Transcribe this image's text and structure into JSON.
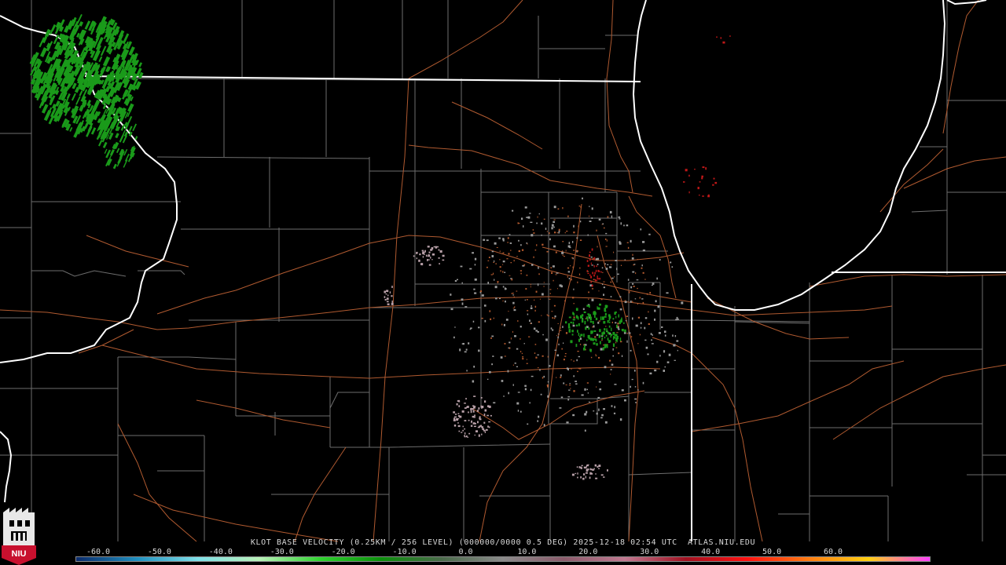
{
  "title": "KLOT BASE VELOCITY (0.25KM / 256 LEVEL) (000000/0000 0.5 DEG) 2025-12-18 02:54 UTC  ATLAS.NIU.EDU",
  "logo": {
    "text": "NIU",
    "colors": {
      "shield": "#c8102e",
      "tower": "#ffffff"
    }
  },
  "colorbar": {
    "ticks": [
      "-60.0",
      "-50.0",
      "-40.0",
      "-30.0",
      "-20.0",
      "-10.0",
      "0.0",
      "10.0",
      "20.0",
      "30.0",
      "40.0",
      "50.0",
      "60.0"
    ],
    "colors": [
      "#0a2a6a",
      "#1f8fbf",
      "#7fe0e8",
      "#b8f0b8",
      "#2fd22f",
      "#0b8f0b",
      "#4a6a4a",
      "#8a8a8a",
      "#8a5a6a",
      "#c07890",
      "#a01020",
      "#ff1010",
      "#ff7a10",
      "#ffd010",
      "#ff40ff"
    ]
  },
  "colors": {
    "state_line": "#ffffff",
    "county_line": "#7a7a7a",
    "road_line": "#b45a2e",
    "inbound_echo": "#1a9a1a",
    "outbound_echo": "#c01818",
    "clutter": "#9a9a9a"
  }
}
